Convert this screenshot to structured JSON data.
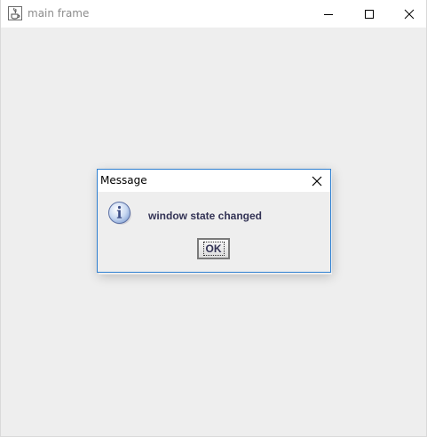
{
  "main_window": {
    "title": "main frame",
    "app_icon": "java-coffee-cup-icon",
    "controls": {
      "minimize_icon": "minimize-icon",
      "maximize_icon": "maximize-icon",
      "close_icon": "close-icon"
    },
    "background_color": "#eeeeee"
  },
  "dialog": {
    "title": "Message",
    "close_icon": "close-icon",
    "message_icon": "information-icon",
    "message": "window state changed",
    "ok_label": "OK",
    "border_color": "#2f80d1",
    "text_color": "#333355"
  }
}
